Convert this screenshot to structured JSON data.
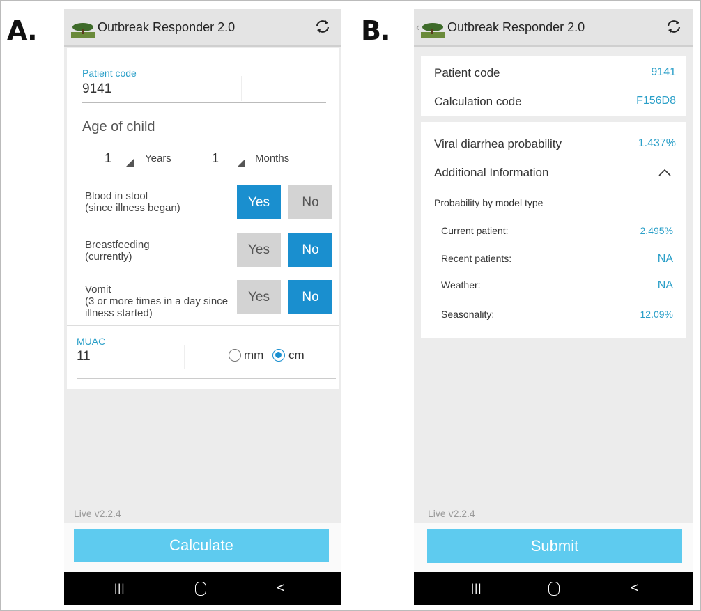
{
  "panel_a": {
    "letter": "A.",
    "app_title": "Outbreak Responder 2.0",
    "patient_code_label": "Patient code",
    "patient_code_value": "9141",
    "age_heading": "Age of child",
    "age_years_value": "1",
    "age_years_label": "Years",
    "age_months_value": "1",
    "age_months_label": "Months",
    "questions": [
      {
        "label_line1": "Blood in stool",
        "label_line2": "(since illness began)",
        "label_line3": "",
        "yes": "Yes",
        "no": "No",
        "selected": "Yes"
      },
      {
        "label_line1": "Breastfeeding",
        "label_line2": "(currently)",
        "label_line3": "",
        "yes": "Yes",
        "no": "No",
        "selected": "No"
      },
      {
        "label_line1": "Vomit",
        "label_line2": "(3 or more times in a day since",
        "label_line3": "illness started)",
        "yes": "Yes",
        "no": "No",
        "selected": "No"
      }
    ],
    "muac_label": "MUAC",
    "muac_value": "11",
    "unit_mm": "mm",
    "unit_cm": "cm",
    "unit_selected": "cm",
    "version": "Live v2.2.4",
    "action_button": "Calculate"
  },
  "panel_b": {
    "letter": "B.",
    "app_title": "Outbreak Responder 2.0",
    "back_glyph": "‹",
    "patient_code_label": "Patient code",
    "patient_code_value": "9141",
    "calc_code_label": "Calculation code",
    "calc_code_value": "F156D8",
    "viral_label": "Viral diarrhea probability",
    "viral_value": "1.437%",
    "additional_label": "Additional Information",
    "model_heading": "Probability by model type",
    "models": [
      {
        "label": "Current patient:",
        "value": "2.495%"
      },
      {
        "label": "Recent patients:",
        "value": "NA"
      },
      {
        "label": "Weather:",
        "value": "NA"
      },
      {
        "label": "Seasonality:",
        "value": "12.09%"
      }
    ],
    "version": "Live v2.2.4",
    "action_button": "Submit"
  },
  "nav": {
    "recent": "|||",
    "home": "O",
    "back": "<"
  },
  "colors": {
    "accent_blue": "#1a8fcf",
    "value_blue": "#2a9fc8",
    "button_light_blue": "#5ecbef",
    "unselected_gray": "#d3d3d3"
  },
  "icons": {
    "refresh": "refresh-icon",
    "logo": "tree-logo-icon",
    "collapse": "chevron-up-icon"
  }
}
